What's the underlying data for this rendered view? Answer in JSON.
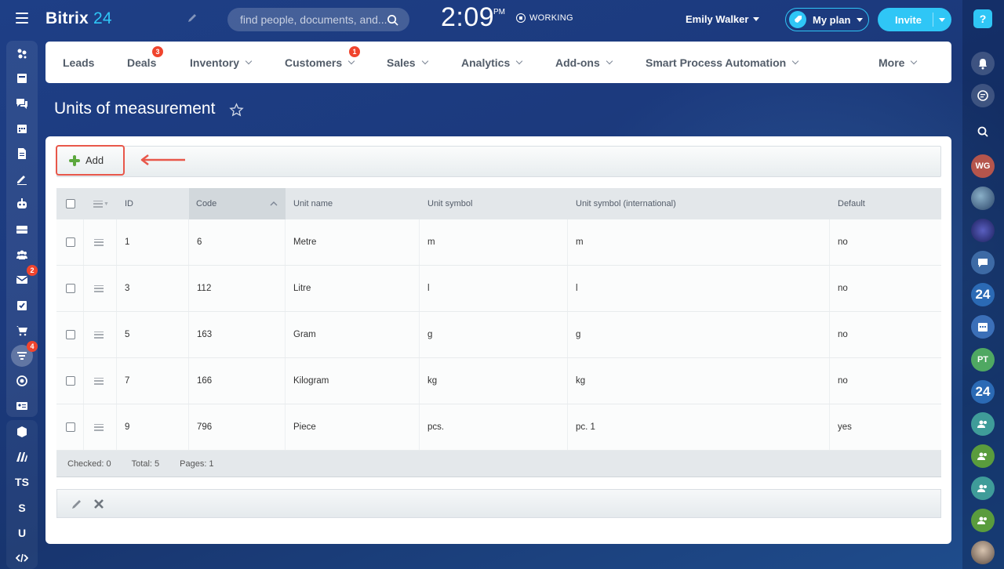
{
  "header": {
    "logo_main": "Bitrix",
    "logo_num": "24",
    "search_placeholder": "find people, documents, and...",
    "clock": "2:09",
    "ampm": "PM",
    "status": "WORKING",
    "user_name": "Emily Walker",
    "plan_label": "My plan",
    "invite_label": "Invite",
    "accent_color": "#2fc6f6"
  },
  "nav": {
    "items": [
      {
        "label": "Leads",
        "badge": ""
      },
      {
        "label": "Deals",
        "badge": "3"
      },
      {
        "label": "Inventory",
        "badge": ""
      },
      {
        "label": "Customers",
        "badge": "1"
      },
      {
        "label": "Sales",
        "badge": ""
      },
      {
        "label": "Analytics",
        "badge": ""
      },
      {
        "label": "Add-ons",
        "badge": ""
      },
      {
        "label": "Smart Process Automation",
        "badge": ""
      },
      {
        "label": "More",
        "badge": ""
      }
    ]
  },
  "left_sidebar": {
    "mail_badge": "2",
    "funnel_badge": "4",
    "text_items": [
      "TS",
      "S",
      "U"
    ]
  },
  "right_sidebar": {
    "avatars": [
      "WG",
      "PT"
    ],
    "badge24": "24",
    "help": "?"
  },
  "page": {
    "title": "Units of measurement",
    "add_label": "Add"
  },
  "table": {
    "columns": [
      "ID",
      "Code",
      "Unit name",
      "Unit symbol",
      "Unit symbol (international)",
      "Default"
    ],
    "rows": [
      [
        "1",
        "6",
        "Metre",
        "m",
        "m",
        "no"
      ],
      [
        "3",
        "112",
        "Litre",
        "l",
        "l",
        "no"
      ],
      [
        "5",
        "163",
        "Gram",
        "g",
        "g",
        "no"
      ],
      [
        "7",
        "166",
        "Kilogram",
        "kg",
        "kg",
        "no"
      ],
      [
        "9",
        "796",
        "Piece",
        "pcs.",
        "pc. 1",
        "yes"
      ]
    ],
    "footer": {
      "checked": "Checked: 0",
      "total": "Total: 5",
      "pages": "Pages:  1"
    }
  }
}
